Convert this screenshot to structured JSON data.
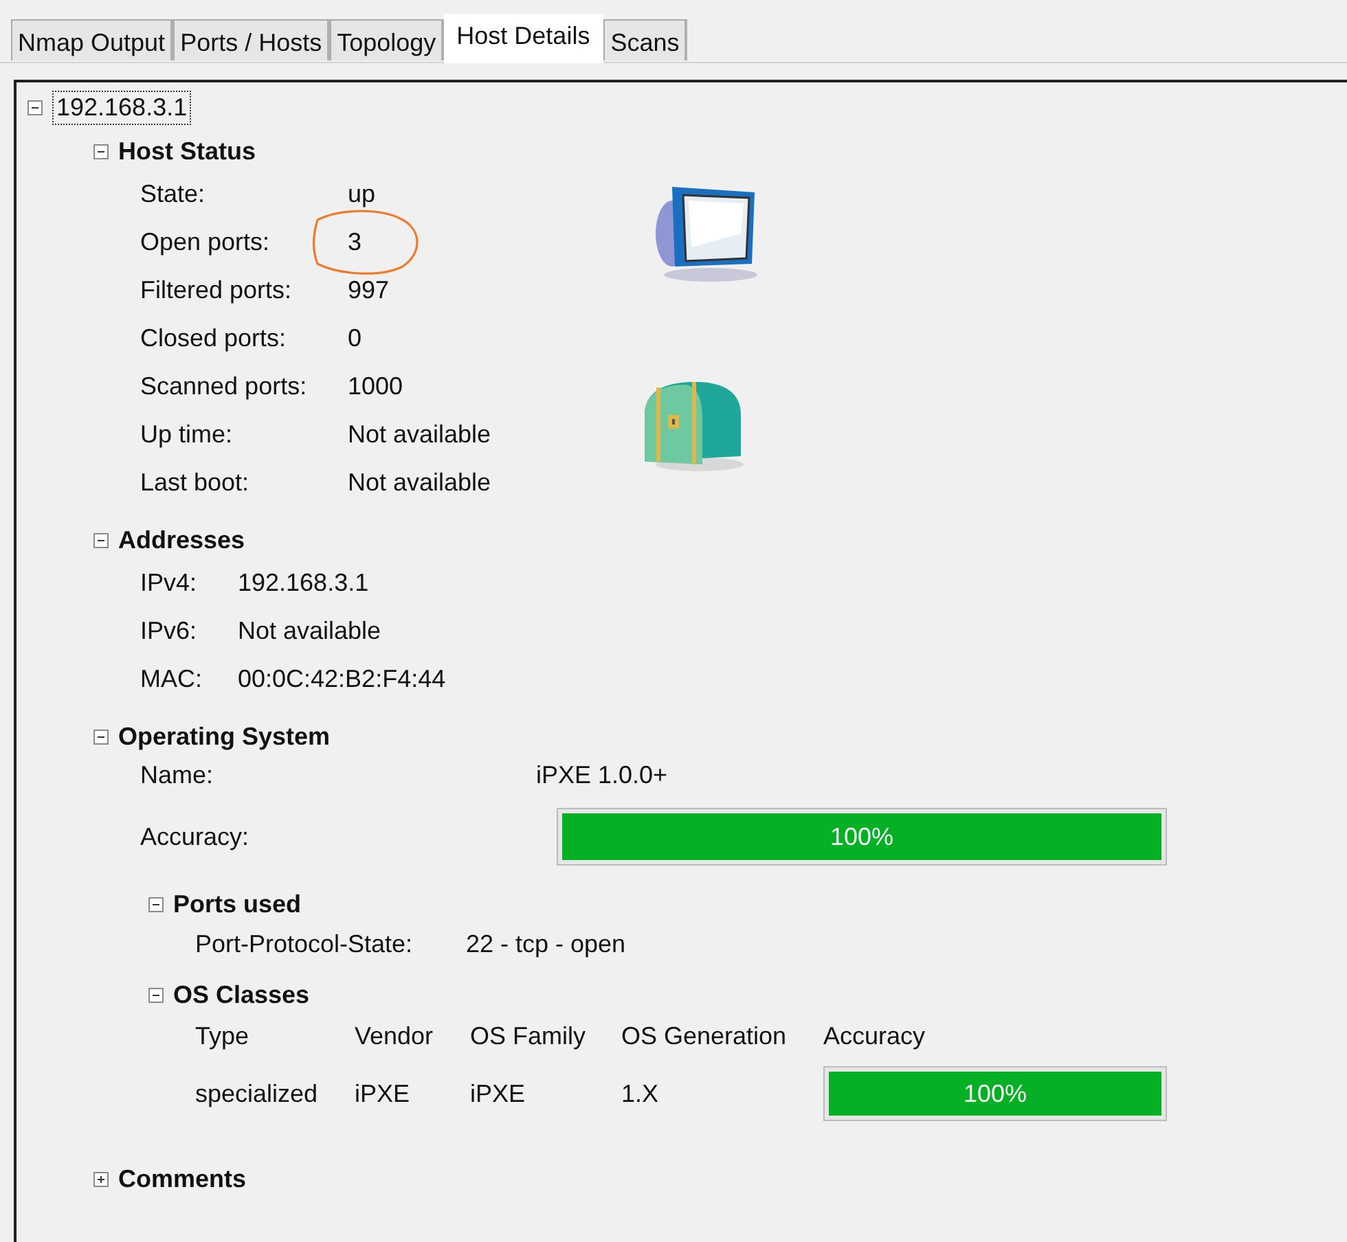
{
  "tabs": [
    {
      "label": "Nmap Output",
      "selected": false
    },
    {
      "label": "Ports / Hosts",
      "selected": false
    },
    {
      "label": "Topology",
      "selected": false
    },
    {
      "label": "Host Details",
      "selected": true
    },
    {
      "label": "Scans",
      "selected": false
    }
  ],
  "host": {
    "address": "192.168.3.1",
    "expanded": true
  },
  "host_status": {
    "title": "Host Status",
    "expanded": true,
    "fields": [
      {
        "label": "State:",
        "value": "up"
      },
      {
        "label": "Open ports:",
        "value": "3",
        "circled": true
      },
      {
        "label": "Filtered ports:",
        "value": "997"
      },
      {
        "label": "Closed ports:",
        "value": "0"
      },
      {
        "label": "Scanned ports:",
        "value": "1000"
      },
      {
        "label": "Up time:",
        "value": "Not available"
      },
      {
        "label": "Last boot:",
        "value": "Not available"
      }
    ]
  },
  "addresses": {
    "title": "Addresses",
    "expanded": true,
    "fields": [
      {
        "label": "IPv4:",
        "value": "192.168.3.1"
      },
      {
        "label": "IPv6:",
        "value": "Not available"
      },
      {
        "label": "MAC:",
        "value": "00:0C:42:B2:F4:44"
      }
    ]
  },
  "operating_system": {
    "title": "Operating System",
    "expanded": true,
    "name_label": "Name:",
    "name": "iPXE 1.0.0+",
    "accuracy_label": "Accuracy:",
    "accuracy": {
      "level": 1,
      "text": "100%"
    },
    "ports_used": {
      "title": "Ports used",
      "expanded": true,
      "fields": [
        {
          "label": "Port-Protocol-State:",
          "value": "22 - tcp - open"
        }
      ]
    },
    "os_classes": {
      "title": "OS Classes",
      "expanded": true,
      "columns": [
        "Type",
        "Vendor",
        "OS Family",
        "OS Generation",
        "Accuracy"
      ],
      "rows": [
        {
          "type": "specialized",
          "vendor": "iPXE",
          "family": "iPXE",
          "generation": "1.X",
          "accuracy": {
            "level": 1,
            "text": "100%"
          }
        }
      ]
    }
  },
  "comments": {
    "title": "Comments",
    "expanded": false
  }
}
